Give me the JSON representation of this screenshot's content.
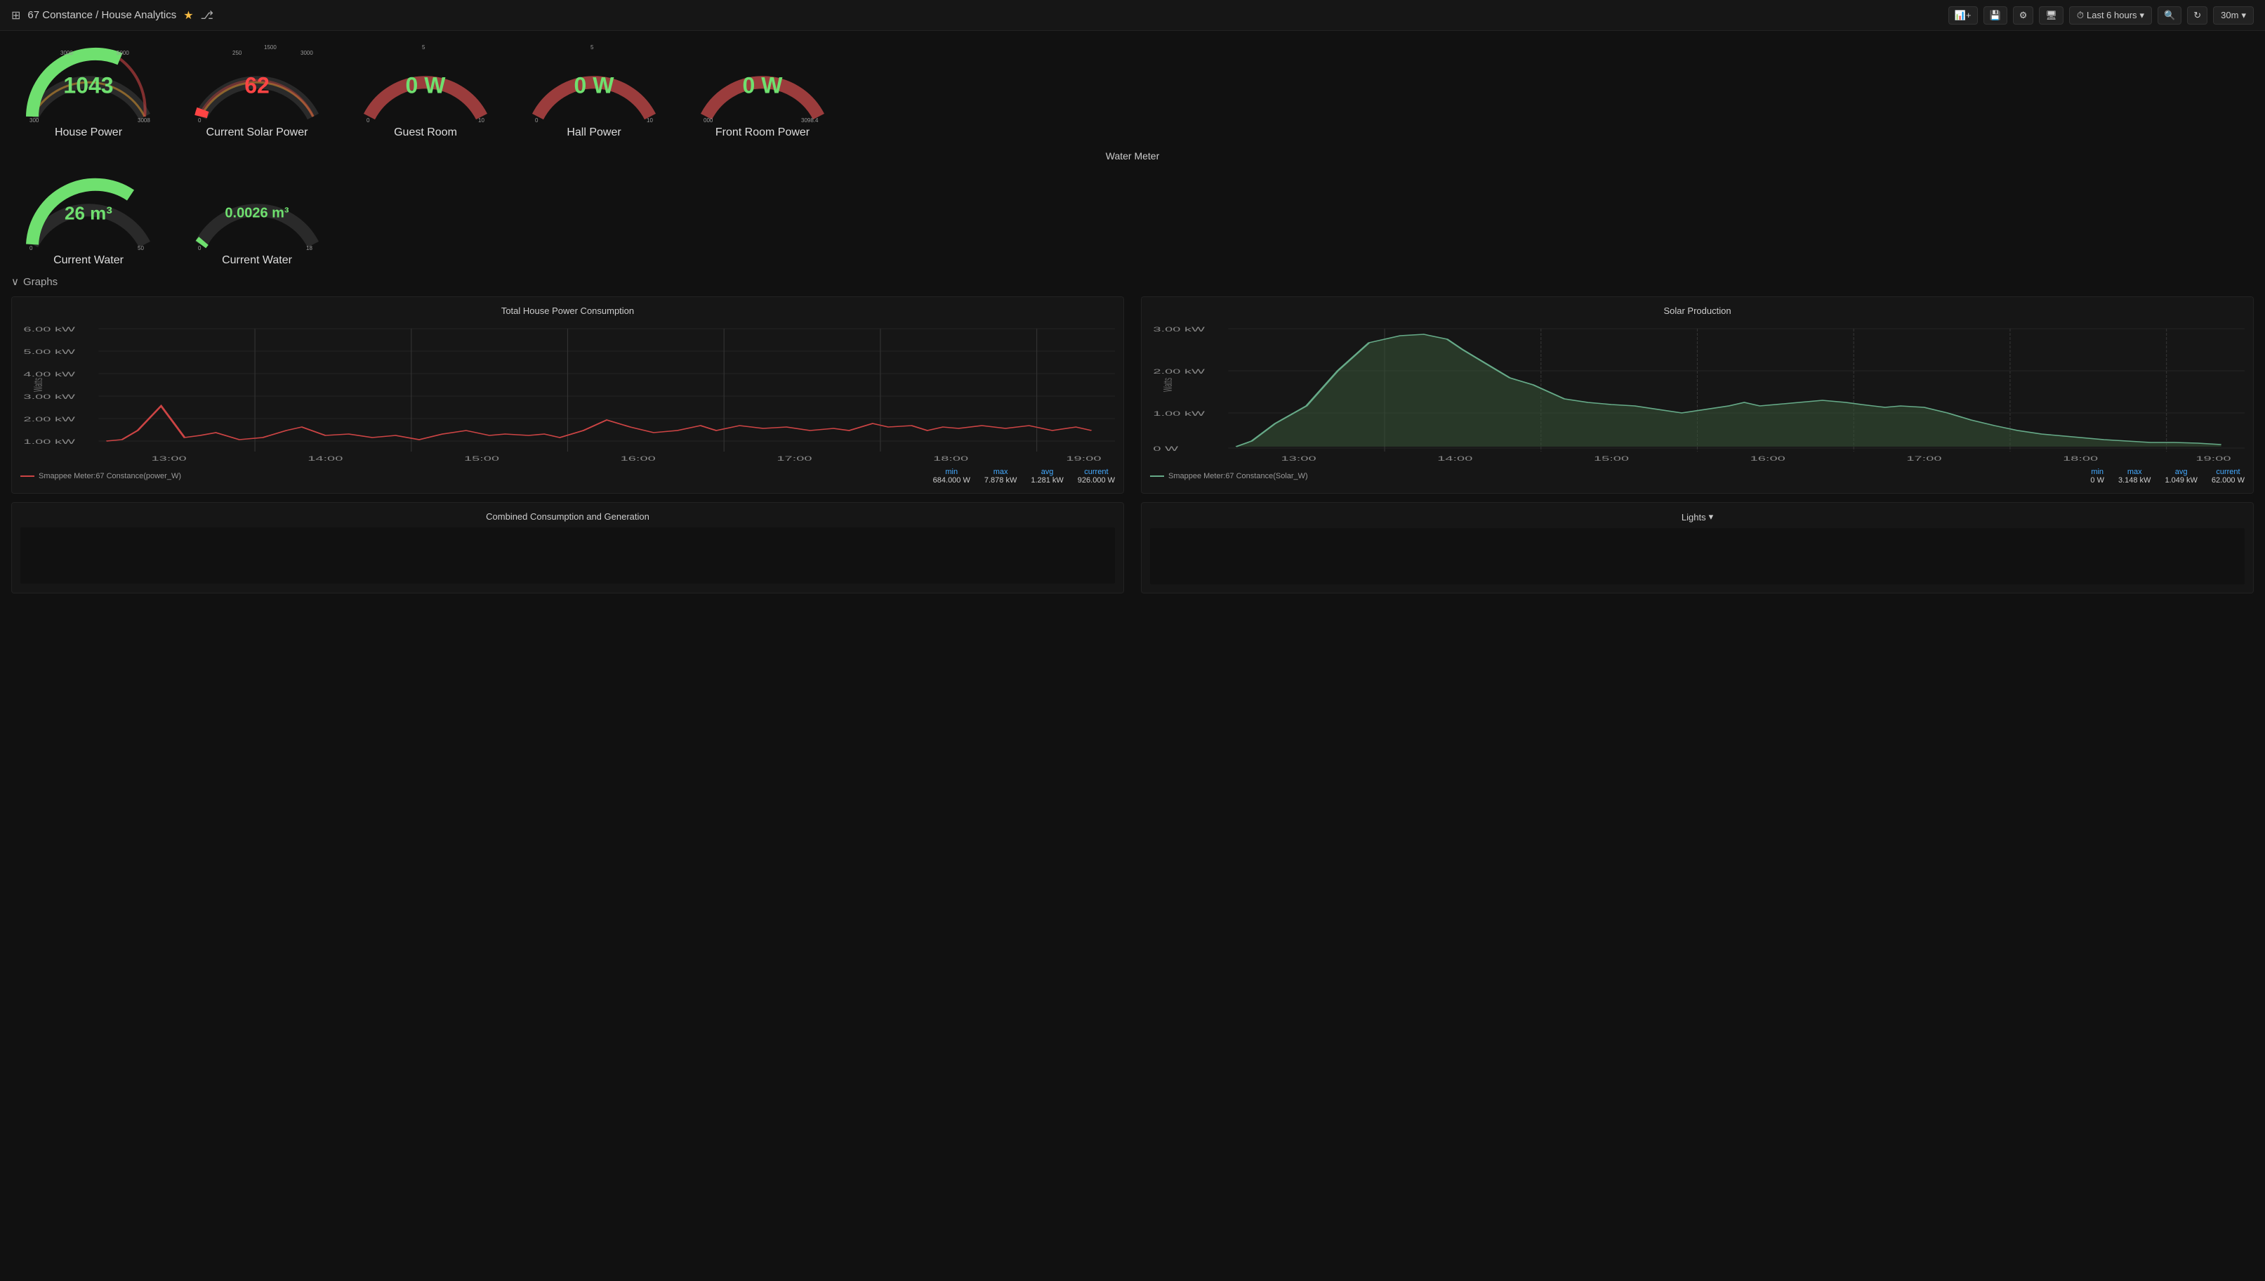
{
  "header": {
    "breadcrumb": "67 Constance / House Analytics",
    "timeRange": "Last 6 hours",
    "refreshInterval": "30m",
    "buttons": {
      "addPanel": "+",
      "save": "💾",
      "settings": "⚙",
      "display": "🖥",
      "zoom": "🔍",
      "refresh": "↻"
    }
  },
  "gauges": [
    {
      "id": "house-power",
      "label": "House Power",
      "value": "1043",
      "unit": "",
      "color": "green",
      "min": "300",
      "max": "3000",
      "tickLabels": [
        "300",
        "3000",
        "5000",
        "3008"
      ],
      "fillColor": "#6fe06f",
      "arcColor": "#6fe06f",
      "redZone": false
    },
    {
      "id": "current-solar",
      "label": "Current Solar Power",
      "value": "62",
      "unit": "",
      "color": "red",
      "min": "0",
      "max": "3000",
      "tickLabels": [
        "250",
        "1500",
        "3000"
      ],
      "fillColor": "#f44",
      "arcColor": "#f44",
      "redZone": true
    },
    {
      "id": "guest-room",
      "label": "Guest Room",
      "value": "0 W",
      "unit": "",
      "color": "green",
      "tickLabels": [
        "0",
        "5",
        "10"
      ],
      "fillColor": "#6fe06f",
      "arcColor": "#6fe06f",
      "redZone": false
    },
    {
      "id": "hall-power",
      "label": "Hall Power",
      "value": "0 W",
      "unit": "",
      "color": "green",
      "tickLabels": [
        "0",
        "5",
        "10"
      ],
      "fillColor": "#6fe06f",
      "arcColor": "#6fe06f",
      "redZone": false
    },
    {
      "id": "front-room",
      "label": "Front Room Power",
      "value": "0 W",
      "unit": "",
      "color": "green",
      "tickLabels": [
        "000",
        "3098.4"
      ],
      "fillColor": "#6fe06f",
      "arcColor": "#6fe06f",
      "redZone": false
    }
  ],
  "waterSection": {
    "label": "Water Meter",
    "gauges": [
      {
        "id": "current-water-1",
        "label": "Current Water",
        "value": "26 m³",
        "color": "green",
        "tickLabels": [
          "0",
          "50"
        ],
        "arcFill": 0.7
      },
      {
        "id": "current-water-2",
        "label": "Current Water",
        "value": "0.0026 m³",
        "color": "green",
        "tickLabels": [
          "0",
          "18"
        ],
        "arcFill": 0.05
      }
    ]
  },
  "graphs": {
    "sectionLabel": "Graphs",
    "charts": [
      {
        "id": "house-power-chart",
        "title": "Total House Power Consumption",
        "yLabel": "Watts",
        "yTicks": [
          "6.00 kW",
          "5.00 kW",
          "4.00 kW",
          "3.00 kW",
          "2.00 kW",
          "1.00 kW"
        ],
        "xTicks": [
          "13:00",
          "14:00",
          "15:00",
          "16:00",
          "17:00",
          "18:00",
          "19:00"
        ],
        "lineColor": "#c44",
        "legendName": "Smappee Meter:67 Constance(power_W)",
        "legendColor": "#c44",
        "stats": {
          "min": {
            "label": "min",
            "value": "684.000 W"
          },
          "max": {
            "label": "max",
            "value": "7.878 kW"
          },
          "avg": {
            "label": "avg",
            "value": "1.281 kW"
          },
          "current": {
            "label": "current",
            "value": "926.000 W"
          }
        }
      },
      {
        "id": "solar-chart",
        "title": "Solar Production",
        "yLabel": "Watts",
        "yTicks": [
          "3.00 kW",
          "2.00 kW",
          "1.00 kW",
          "0 W"
        ],
        "xTicks": [
          "13:00",
          "14:00",
          "15:00",
          "16:00",
          "17:00",
          "18:00",
          "19:00"
        ],
        "lineColor": "#6a8",
        "legendName": "Smappee Meter:67 Constance(Solar_W)",
        "legendColor": "#6a8",
        "stats": {
          "min": {
            "label": "min",
            "value": "0 W"
          },
          "max": {
            "label": "max",
            "value": "3.148 kW"
          },
          "avg": {
            "label": "avg",
            "value": "1.049 kW"
          },
          "current": {
            "label": "current",
            "value": "62.000 W"
          }
        }
      }
    ]
  },
  "bottomPanels": {
    "left": {
      "title": "Combined Consumption and Generation"
    },
    "right": {
      "title": "Lights",
      "hasDropdown": true
    }
  }
}
